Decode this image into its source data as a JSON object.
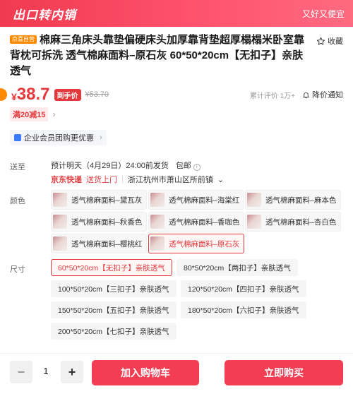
{
  "banner": {
    "title": "出口转内销",
    "slogan": "又好又便宜"
  },
  "product": {
    "self_tag": "京喜自营",
    "title": "棉麻三角床头靠垫偏硬床头加厚靠背垫超厚榻榻米卧室靠背枕可拆洗 透气棉麻面料–原石灰 60*50*20cm【无扣子】亲肤透气",
    "favorite_label": "收藏"
  },
  "price": {
    "symbol": "¥",
    "current": "38.7",
    "tag": "到手价",
    "original": "¥53.70",
    "reviews_label": "累计评价",
    "reviews_count": "1万+",
    "notify_label": "降价通知"
  },
  "promo": {
    "label": "满20减15",
    "arrow": "›"
  },
  "enterprise": {
    "label": "企业会员团购更优惠",
    "arrow": "›"
  },
  "delivery": {
    "label": "送至",
    "estimate": "预计明天（4月29日）24:00前发货",
    "freight": "包邮",
    "info_icon": "i",
    "courier": "京东快递",
    "door": "送货上门",
    "divider": "|",
    "address": "浙江杭州市萧山区所前镇",
    "address_arrow": "⌄"
  },
  "color": {
    "label": "颜色",
    "options": [
      {
        "label": "透气棉麻面料–黛瓦灰",
        "selected": false
      },
      {
        "label": "透气棉麻面料–海棠红",
        "selected": false
      },
      {
        "label": "透气棉麻面料–麻本色",
        "selected": false
      },
      {
        "label": "透气棉麻面料–秋香色",
        "selected": false
      },
      {
        "label": "透气棉麻面料–香咖色",
        "selected": false
      },
      {
        "label": "透气棉麻面料–杏白色",
        "selected": false
      },
      {
        "label": "透气棉麻面料–樱桃红",
        "selected": false
      },
      {
        "label": "透气棉麻面料–原石灰",
        "selected": true
      }
    ]
  },
  "size": {
    "label": "尺寸",
    "options": [
      {
        "label": "60*50*20cm【无扣子】亲肤透气",
        "selected": true
      },
      {
        "label": "80*50*20cm【两扣子】亲肤透气",
        "selected": false
      },
      {
        "label": "100*50*20cm【三扣子】亲肤透气",
        "selected": false
      },
      {
        "label": "120*50*20cm【四扣子】亲肤透气",
        "selected": false
      },
      {
        "label": "150*50*20cm【五扣子】亲肤透气",
        "selected": false
      },
      {
        "label": "180*50*20cm【六扣子】亲肤透气",
        "selected": false
      },
      {
        "label": "200*50*20cm【七扣子】亲肤透气",
        "selected": false
      }
    ]
  },
  "quantity": {
    "minus": "−",
    "value": "1",
    "plus": "+"
  },
  "actions": {
    "add_to_cart": "加入购物车",
    "buy_now": "立即购买"
  },
  "colors": {
    "accent": "#e4393c",
    "cta": "#f23d52",
    "banner": "#ff4d66",
    "self_tag": "#ff8a00"
  },
  "icons": {
    "favorite": "star-outline-icon",
    "notify": "bell-icon",
    "enterprise": "enterprise-icon"
  }
}
